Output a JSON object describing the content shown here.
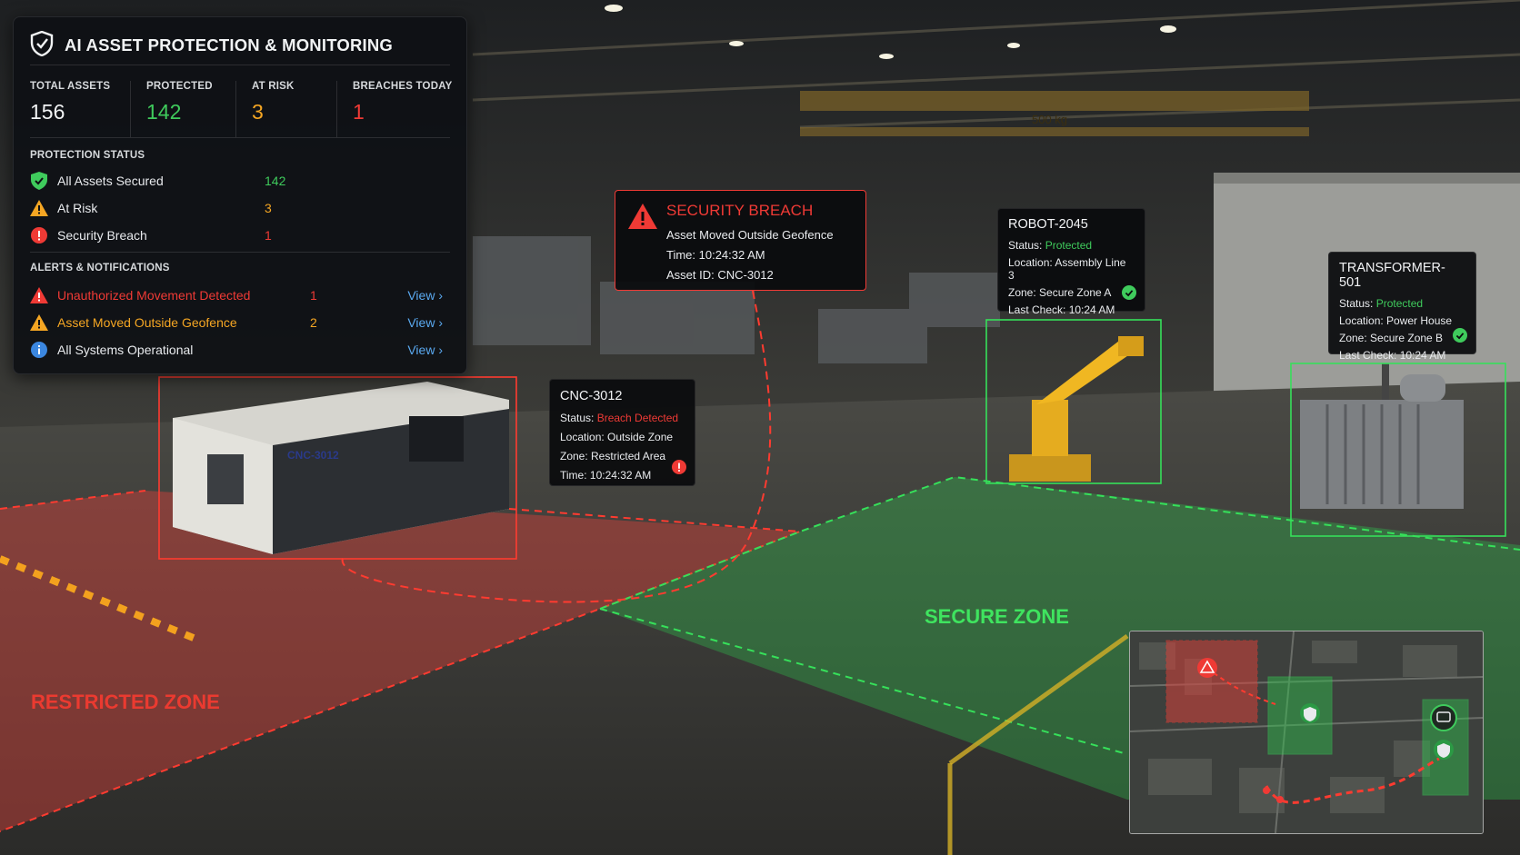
{
  "panel": {
    "title": "AI ASSET PROTECTION & MONITORING",
    "stats": [
      {
        "label": "TOTAL ASSETS",
        "value": "156",
        "color": "#f1f3f4"
      },
      {
        "label": "PROTECTED",
        "value": "142",
        "color": "#3fcb5c"
      },
      {
        "label": "AT RISK",
        "value": "3",
        "color": "#f5a623"
      },
      {
        "label": "BREACHES TODAY",
        "value": "1",
        "color": "#ef3a35"
      }
    ],
    "protection_status": {
      "title": "PROTECTION STATUS",
      "items": [
        {
          "icon": "shield-check-icon",
          "label": "All Assets Secured",
          "count": "142",
          "color": "#3fcb5c"
        },
        {
          "icon": "warning-icon",
          "label": "At Risk",
          "count": "3",
          "color": "#f5a623"
        },
        {
          "icon": "alert-circle-icon",
          "label": "Security Breach",
          "count": "1",
          "color": "#ef3a35"
        }
      ]
    },
    "alerts": {
      "title": "ALERTS & NOTIFICATIONS",
      "items": [
        {
          "icon": "warning-icon",
          "label": "Unauthorized Movement Detected",
          "count": "1",
          "link": "View ›",
          "color": "#ef3a35"
        },
        {
          "icon": "warning-icon",
          "label": "Asset Moved Outside Geofence",
          "count": "2",
          "link": "View ›",
          "color": "#f5a623"
        },
        {
          "icon": "info-icon",
          "label": "All Systems Operational",
          "count": "",
          "link": "View ›",
          "color": "#e8eaed"
        }
      ]
    }
  },
  "breach_card": {
    "title": "SECURITY BREACH",
    "line1": "Asset Moved Outside Geofence",
    "line2": "Time: 10:24:32 AM",
    "line3": "Asset ID: CNC-3012"
  },
  "cnc_card": {
    "name": "CNC-3012",
    "status_label": "Status:",
    "status_value": "Breach Detected",
    "location": "Location: Outside Zone",
    "zone": "Zone: Restricted Area",
    "time": "Time: 10:24:32 AM"
  },
  "robot_card": {
    "name": "ROBOT-2045",
    "status_label": "Status:",
    "status_value": "Protected",
    "location": "Location: Assembly Line 3",
    "zone": "Zone: Secure Zone A",
    "last_check": "Last Check: 10:24 AM"
  },
  "transformer_card": {
    "name": "TRANSFORMER-501",
    "status_label": "Status:",
    "status_value": "Protected",
    "location": "Location: Power House",
    "zone": "Zone: Secure Zone B",
    "last_check": "Last Check: 10:24 AM"
  },
  "zones": {
    "secure": "SECURE ZONE",
    "restricted": "RESTRICTED ZONE"
  },
  "scene_text": {
    "crane_capacity": "500 kg",
    "machine_label": "CNC-3012"
  },
  "colors": {
    "protected": "#3fcb5c",
    "at_risk": "#f5a623",
    "breach": "#ef3a35",
    "link": "#5aa9f0"
  }
}
